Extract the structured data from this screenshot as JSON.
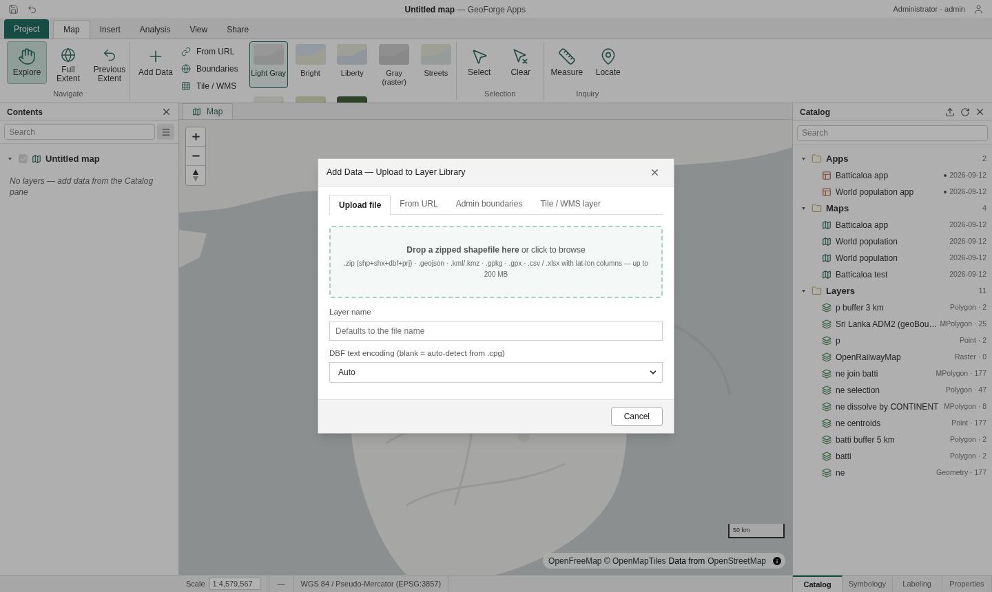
{
  "title_bar": {
    "document": "Untitled map",
    "app": "— GeoForge Apps",
    "user": "Administrator · admin"
  },
  "ribbon_tabs": [
    {
      "label": "Project",
      "kind": "file",
      "selected": false
    },
    {
      "label": "Map",
      "kind": "tab",
      "selected": true
    },
    {
      "label": "Insert",
      "kind": "tab",
      "selected": false
    },
    {
      "label": "Analysis",
      "kind": "tab",
      "selected": false
    },
    {
      "label": "View",
      "kind": "tab",
      "selected": false
    },
    {
      "label": "Share",
      "kind": "tab",
      "selected": false
    }
  ],
  "navigate": {
    "label": "Navigate",
    "tools": [
      {
        "label": "Explore",
        "selected": true
      },
      {
        "label": "Full Extent",
        "selected": false
      },
      {
        "label": "Previous Extent",
        "selected": false
      }
    ]
  },
  "add_data": {
    "button": "Add Data",
    "links": [
      "From URL",
      "Boundaries",
      "Tile / WMS"
    ],
    "basemaps": [
      {
        "label": "Light Gray",
        "selected": true
      },
      {
        "label": "Bright",
        "selected": false
      },
      {
        "label": "Liberty",
        "selected": false
      },
      {
        "label": "Gray (raster)",
        "selected": false
      },
      {
        "label": "Streets",
        "selected": false
      },
      {
        "selected": false
      },
      {
        "selected": false
      },
      {
        "selected": false
      }
    ]
  },
  "selection": {
    "label": "Selection",
    "tools": [
      "Select",
      "Clear"
    ]
  },
  "inquiry": {
    "label": "Inquiry",
    "tools": [
      "Measure",
      "Locate"
    ]
  },
  "contents": {
    "title": "Contents",
    "search_placeholder": "Search",
    "map": {
      "name": "Untitled map",
      "checked": true,
      "expanded": true
    },
    "empty_note": "No layers — add data from the Catalog pane"
  },
  "map_view": {
    "tab": "Map",
    "scale_bar": "50 km",
    "attribution": [
      {
        "text": "OpenFreeMap © OpenMapTiles",
        "kind": "link"
      },
      {
        "text": "Data from",
        "kind": "plain"
      },
      {
        "text": "OpenStreetMap",
        "kind": "link"
      }
    ]
  },
  "dialog": {
    "title": "Add Data — Upload to Layer Library",
    "tabs": [
      {
        "label": "Upload file",
        "selected": true
      },
      {
        "label": "From URL",
        "selected": false
      },
      {
        "label": "Admin boundaries",
        "selected": false
      },
      {
        "label": "Tile / WMS layer",
        "selected": false
      }
    ],
    "drop_zone": {
      "prompt": "**Drop a zipped shapefile here** or click to browse",
      "formats": ".zip (shp+shx+dbf+prj) · .geojson · .kml/.kmz · .gpkg · .gpx · .csv / .xlsx with lat-lon columns — up to 200 MB"
    },
    "layer_name": {
      "label": "Layer name",
      "placeholder": "Defaults to the file name"
    },
    "encoding": {
      "label": "DBF text encoding (blank = auto-detect from .cpg)",
      "value": "Auto"
    },
    "buttons": [
      "Cancel"
    ]
  },
  "catalog": {
    "title": "Catalog",
    "search_placeholder": "Search",
    "groups": [
      {
        "name": "Apps",
        "count": "2",
        "expanded": true,
        "kind": "app",
        "items": [
          {
            "name": "Batticaloa app",
            "meta": "2026-09-12",
            "marked": true
          },
          {
            "name": "World population app",
            "meta": "2026-09-12",
            "marked": true
          }
        ]
      },
      {
        "name": "Maps",
        "count": "4",
        "expanded": true,
        "kind": "map",
        "items": [
          {
            "name": "Batticaloa app",
            "meta": "2026-09-12",
            "marked": false
          },
          {
            "name": "World population",
            "meta": "2026-09-12",
            "marked": false
          },
          {
            "name": "World population",
            "meta": "2026-09-12",
            "marked": false
          },
          {
            "name": "Batticaloa test",
            "meta": "2026-09-12",
            "marked": false
          }
        ]
      },
      {
        "name": "Layers",
        "count": "11",
        "expanded": true,
        "kind": "layer",
        "items": [
          {
            "name": "p buffer 3 km",
            "meta": "Polygon · 2"
          },
          {
            "name": "Sri Lanka ADM2 (geoBou…",
            "meta": "MPolygon · 25"
          },
          {
            "name": "p",
            "meta": "Point · 2"
          },
          {
            "name": "OpenRailwayMap",
            "meta": "Raster · 0"
          },
          {
            "name": "ne join batti",
            "meta": "MPolygon · 177"
          },
          {
            "name": "ne selection",
            "meta": "Polygon · 47"
          },
          {
            "name": "ne dissolve by CONTINENT",
            "meta": "MPolygon · 8"
          },
          {
            "name": "ne centroids",
            "meta": "Point · 177"
          },
          {
            "name": "batti buffer 5 km",
            "meta": "Polygon · 2"
          },
          {
            "name": "batti",
            "meta": "Polygon · 2"
          },
          {
            "name": "ne",
            "meta": "Geometry · 177"
          }
        ]
      }
    ]
  },
  "pane_tabs": [
    {
      "label": "Catalog",
      "selected": true
    },
    {
      "label": "Symbology",
      "selected": false
    },
    {
      "label": "Labeling",
      "selected": false
    },
    {
      "label": "Properties",
      "selected": false
    }
  ],
  "status_bar": {
    "scale_label": "Scale",
    "scale": "1:4,579,567",
    "separator": "—",
    "crs": "WGS 84 / Pseudo-Mercator (EPSG:3857)"
  }
}
